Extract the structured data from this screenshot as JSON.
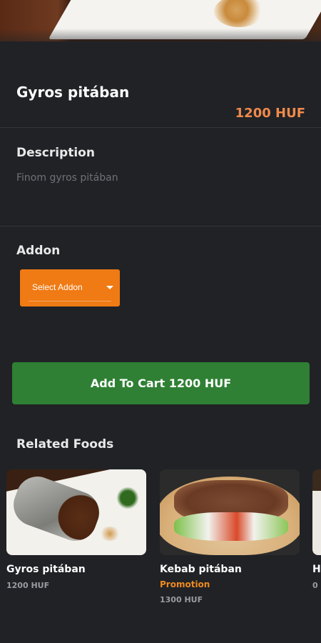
{
  "product": {
    "name": "Gyros pitában",
    "price": "1200 HUF"
  },
  "description": {
    "heading": "Description",
    "text": "Finom gyros pitában"
  },
  "addon": {
    "heading": "Addon",
    "select_label": "Select Addon"
  },
  "cart": {
    "button_label": "Add To Cart 1200 HUF"
  },
  "related": {
    "heading": "Related Foods",
    "items": [
      {
        "name": "Gyros pitában",
        "promotion": "",
        "price": "1200 HUF"
      },
      {
        "name": "Kebab pitában",
        "promotion": "Promotion",
        "price": "1300 HUF"
      },
      {
        "name": "H",
        "promotion": "",
        "price": "0"
      }
    ]
  },
  "colors": {
    "background": "#202226",
    "accent_orange": "#f07a14",
    "price_orange": "#f08a4b",
    "cart_green": "#2f8034"
  }
}
